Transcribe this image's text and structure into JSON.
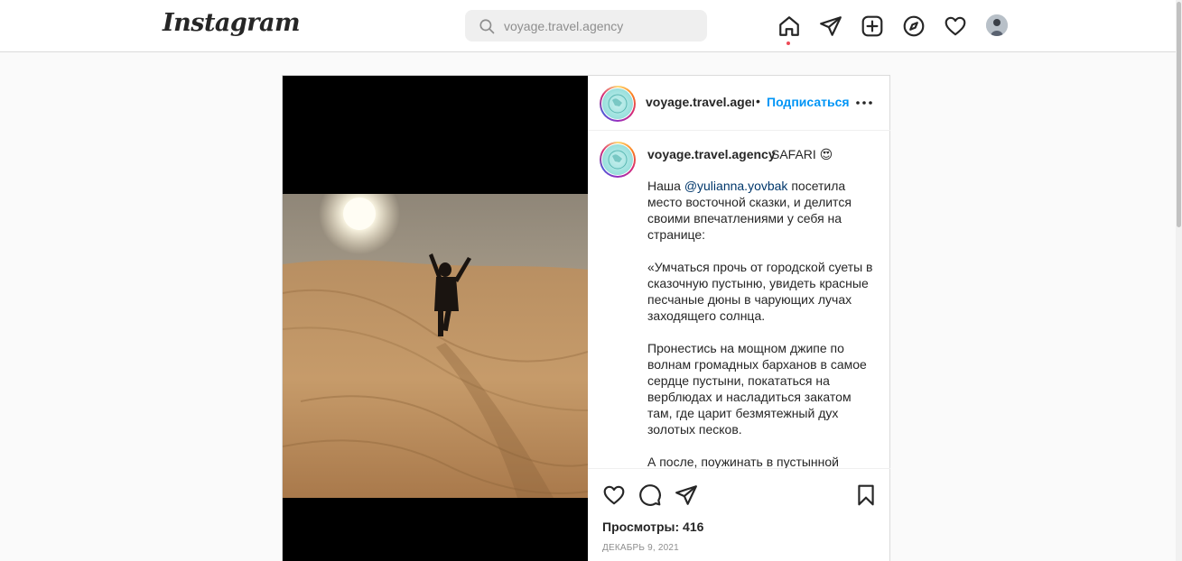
{
  "app": {
    "logo": "Instagram"
  },
  "search": {
    "placeholder": "voyage.travel.agency"
  },
  "nav": {
    "icons": [
      "home-icon",
      "direct-message-icon",
      "new-post-icon",
      "explore-icon",
      "activity-heart-icon",
      "profile-avatar"
    ]
  },
  "post": {
    "username": "voyage.travel.agency",
    "dot": "•",
    "follow_label": "Подписаться",
    "caption": {
      "username": "voyage.travel.agency",
      "headline": "SAFARI 😍",
      "intro_before": "Наша ",
      "mention": "@yulianna.yovbak",
      "intro_after": " посетила место восточной сказки, и делится своими впечатлениями у себя на странице:",
      "paragraph2": "«Умчаться прочь от городской суеты в сказочную пустыню, увидеть красные песчаные дюны в чарующих лучах заходящего солнца.",
      "paragraph3": "Пронестись на мощном джипе по волнам громадных барханов в самое сердце пустыни, покататься на верблюдах и насладиться закатом там, где царит безмятежный дух золотых песков.",
      "paragraph4": "А после, поужинать в пустынной"
    },
    "views_label": "Просмотры: 416",
    "date": "ДЕКАБРЬ 9, 2021"
  },
  "colors": {
    "accent": "#0095f6",
    "mention": "#00376b",
    "notification_dot": "#ed4956",
    "border": "#dbdbdb"
  }
}
